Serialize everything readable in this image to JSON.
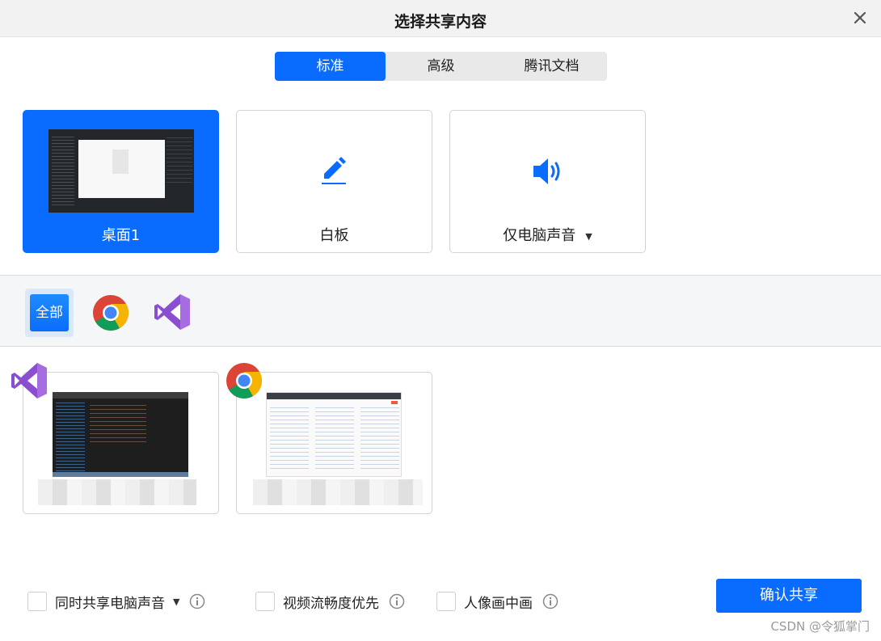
{
  "window": {
    "title": "选择共享内容"
  },
  "tabs": [
    {
      "label": "标准",
      "active": true
    },
    {
      "label": "高级",
      "active": false
    },
    {
      "label": "腾讯文档",
      "active": false
    }
  ],
  "share_cards": [
    {
      "label": "桌面1",
      "selected": true,
      "icon": "desktop-thumbnail"
    },
    {
      "label": "白板",
      "selected": false,
      "icon": "pen-icon"
    },
    {
      "label": "仅电脑声音",
      "selected": false,
      "icon": "speaker-icon",
      "has_dropdown": true
    }
  ],
  "filters": [
    {
      "label": "全部",
      "active": true
    },
    {
      "icon": "chrome-icon"
    },
    {
      "icon": "visual-studio-icon"
    }
  ],
  "windows": [
    {
      "app_icon": "visual-studio-icon",
      "title_blurred": true
    },
    {
      "app_icon": "chrome-icon",
      "title_blurred": true
    }
  ],
  "options": [
    {
      "label": "同时共享电脑声音",
      "checked": false,
      "has_dropdown": true,
      "info_icon": "info-icon"
    },
    {
      "label": "视频流畅度优先",
      "checked": false,
      "info_icon": "info-icon"
    },
    {
      "label": "人像画中画",
      "checked": false,
      "info_icon": "info-icon"
    }
  ],
  "confirm": {
    "label": "确认共享"
  },
  "watermark": "CSDN @令狐掌门",
  "colors": {
    "accent": "#0a6cff",
    "vs_purple": "#8a4fd1"
  },
  "glyphs": {
    "caret": "▼"
  }
}
